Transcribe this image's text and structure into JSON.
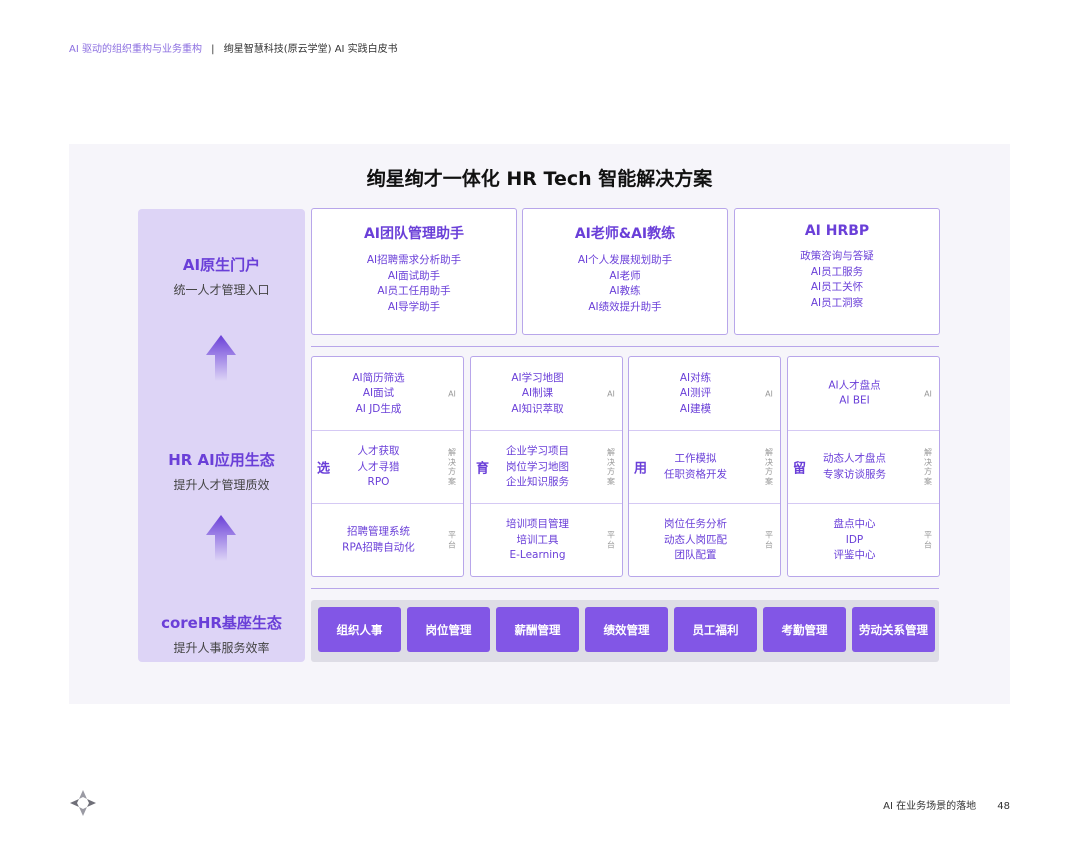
{
  "header": {
    "crumb_primary": "AI 驱动的组织重构与业务重构",
    "separator": "|",
    "crumb_secondary": "绚星智慧科技(原云学堂) AI 实践白皮书"
  },
  "diagram": {
    "title": "绚星绚才一体化 HR Tech 智能解决方案",
    "layers": [
      {
        "title": "AI原生门户",
        "subtitle": "统一人才管理入口"
      },
      {
        "title": "HR AI应用生态",
        "subtitle": "提升人才管理质效"
      },
      {
        "title": "coreHR基座生态",
        "subtitle": "提升人事服务效率"
      }
    ],
    "top_cards": [
      {
        "title": "AI团队管理助手",
        "items": [
          "AI招聘需求分析助手",
          "AI面试助手",
          "AI员工任用助手",
          "AI导学助手"
        ]
      },
      {
        "title": "AI老师&AI教练",
        "items": [
          "AI个人发展规划助手",
          "AI老师",
          "AI教练",
          "AI绩效提升助手"
        ]
      },
      {
        "title": "AI HRBP",
        "items": [
          "政策咨询与答疑",
          "AI员工服务",
          "AI员工关怀",
          "AI员工洞察"
        ]
      }
    ],
    "columns": [
      {
        "char": "选",
        "rows": [
          [
            "AI简历筛选",
            "AI面试",
            "AI JD生成"
          ],
          [
            "人才获取",
            "人才寻猎",
            "RPO"
          ],
          [
            "招聘管理系统",
            "RPA招聘自动化"
          ]
        ]
      },
      {
        "char": "育",
        "rows": [
          [
            "AI学习地图",
            "AI制课",
            "AI知识萃取"
          ],
          [
            "企业学习项目",
            "岗位学习地图",
            "企业知识服务"
          ],
          [
            "培训项目管理",
            "培训工具",
            "E-Learning"
          ]
        ]
      },
      {
        "char": "用",
        "rows": [
          [
            "AI对练",
            "AI测评",
            "AI建模"
          ],
          [
            "工作模拟",
            "任职资格开发"
          ],
          [
            "岗位任务分析",
            "动态人岗匹配",
            "团队配置"
          ]
        ]
      },
      {
        "char": "留",
        "rows": [
          [
            "AI人才盘点",
            "AI BEI"
          ],
          [
            "动态人才盘点",
            "专家访谈服务"
          ],
          [
            "盘点中心",
            "IDP",
            "评鉴中心"
          ]
        ]
      }
    ],
    "row_tags": [
      "AI",
      "解决方案",
      "平台"
    ],
    "core_modules": [
      "组织人事",
      "岗位管理",
      "薪酬管理",
      "绩效管理",
      "员工福利",
      "考勤管理",
      "劳动关系管理"
    ]
  },
  "colors": {
    "accent": "#6a3fd8",
    "button": "#8256e6",
    "left_column": "#ddd4f6",
    "border": "#b8a6ea"
  },
  "footer": {
    "logo_icon": "xuanxing-logo-icon",
    "section": "AI 在业务场景的落地",
    "page_number": "48"
  }
}
